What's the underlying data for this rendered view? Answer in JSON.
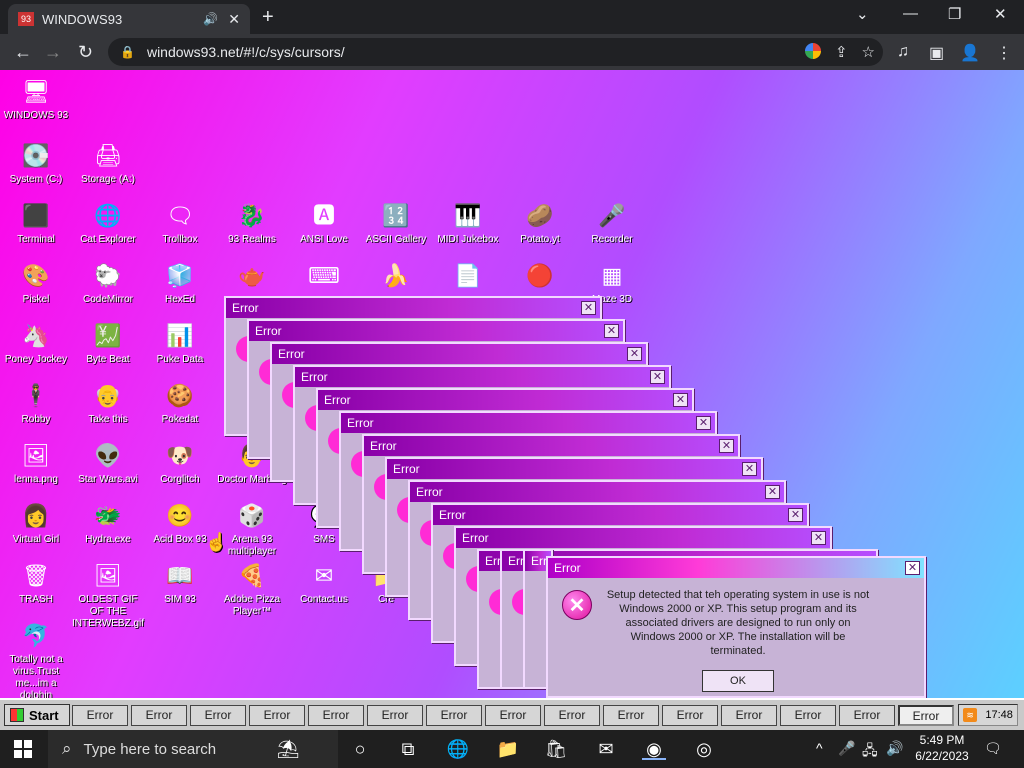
{
  "browser": {
    "tab_title": "WINDOWS93",
    "audio_icon": "🔊",
    "close_glyph": "✕",
    "newtab_glyph": "+",
    "url": "windows93.net/#!/c/sys/cursors/",
    "lock_glyph": "🔒",
    "back": "←",
    "forward": "→",
    "reload": "↻",
    "winctl": {
      "chevron": "⌄",
      "min": "—",
      "max": "❐",
      "close": "✕"
    },
    "omni_icons": {
      "share": "⇪",
      "star": "☆"
    },
    "toolbar_icons": {
      "media": "♫",
      "sidepanel": "▣",
      "profile": "👤",
      "menu": "⋮"
    }
  },
  "desktop": {
    "icons": [
      {
        "label": "WINDOWS 93",
        "glyph": "🖥"
      },
      {
        "label": "System (C:)",
        "glyph": "💽"
      },
      {
        "label": "Storage (A:)",
        "glyph": "🖨"
      },
      {
        "label": "Terminal",
        "glyph": "⬛"
      },
      {
        "label": "Cat Explorer",
        "glyph": "🌐"
      },
      {
        "label": "Trollbox",
        "glyph": "🗨"
      },
      {
        "label": "93 Realms",
        "glyph": "🐉"
      },
      {
        "label": "ANSI Love",
        "glyph": "🅰"
      },
      {
        "label": "ASCII Gallery",
        "glyph": "🔢"
      },
      {
        "label": "MIDI Jukebox",
        "glyph": "🎹"
      },
      {
        "label": "Potato.yt",
        "glyph": "🥔"
      },
      {
        "label": "Recorder",
        "glyph": "🎤"
      },
      {
        "label": "Piskel",
        "glyph": "🎨"
      },
      {
        "label": "CodeMirror",
        "glyph": "🐑"
      },
      {
        "label": "HexEd",
        "glyph": "🧊"
      },
      {
        "label": "",
        "glyph": "🫖"
      },
      {
        "label": "",
        "glyph": "⌨"
      },
      {
        "label": "",
        "glyph": "🍌"
      },
      {
        "label": "",
        "glyph": "📄"
      },
      {
        "label": "",
        "glyph": "🔴"
      },
      {
        "label": "Maze 3D",
        "glyph": "▦"
      },
      {
        "label": "Poney Jockey",
        "glyph": "🦄"
      },
      {
        "label": "Byte Beat",
        "glyph": "💹"
      },
      {
        "label": "Puke Data",
        "glyph": "📊"
      },
      {
        "label": "Robby",
        "glyph": "🕴"
      },
      {
        "label": "Take this",
        "glyph": "👴"
      },
      {
        "label": "Pokedat",
        "glyph": "🍪"
      },
      {
        "label": "lenna.png",
        "glyph": "🖼"
      },
      {
        "label": "Star Wars.avi",
        "glyph": "👽"
      },
      {
        "label": "Corglitch",
        "glyph": "🐶"
      },
      {
        "label": "Doctor Marburg",
        "glyph": "👨"
      },
      {
        "label": "Virtual Girl",
        "glyph": "👩"
      },
      {
        "label": "Hydra.exe",
        "glyph": "🐲"
      },
      {
        "label": "Acid Box 93",
        "glyph": "😊"
      },
      {
        "label": "Arena 93 multiplayer",
        "glyph": "🎲"
      },
      {
        "label": "SMS",
        "glyph": "💬"
      },
      {
        "label": "TRASH",
        "glyph": "🗑"
      },
      {
        "label": "OLDEST GIF OF THE INTERWEBZ.gif",
        "glyph": "🖼"
      },
      {
        "label": "SIM 93",
        "glyph": "📖"
      },
      {
        "label": "Adobe Pizza Player™",
        "glyph": "🍕"
      },
      {
        "label": "Contact.us",
        "glyph": "✉"
      },
      {
        "label": "Cre",
        "glyph": "📁"
      },
      {
        "label": "Totally not a virus.Trust me...im a dolphin",
        "glyph": "🐬"
      }
    ],
    "error_window_title": "Error",
    "error_back_titles": [
      "Error",
      "Error",
      "Error",
      "Error",
      "Error",
      "Error",
      "Error",
      "Error",
      "Error",
      "Error",
      "Error",
      "Err",
      "Err"
    ],
    "main_dialog": {
      "title": "Error",
      "message": "Setup detected that teh operating system in use is not Windows 2000 or XP. This setup program and its associated drivers are designed to run only on Windows 2000 or XP. The installation will be terminated.",
      "ok_label": "OK",
      "close_glyph": "✕",
      "icon_glyph": "✕"
    }
  },
  "w93_taskbar": {
    "start_label": "Start",
    "buttons": [
      "Error",
      "Error",
      "Error",
      "Error",
      "Error",
      "Error",
      "Error",
      "Error",
      "Error",
      "Error",
      "Error",
      "Error",
      "Error",
      "Error",
      "Error"
    ],
    "time": "17:48",
    "rss": "≋"
  },
  "win_taskbar": {
    "search_placeholder": "Type here to search",
    "search_glyph": "⌕",
    "time": "5:49 PM",
    "date": "6/22/2023",
    "apps": [
      "○",
      "⧉",
      "🌐",
      "📁",
      "🛍",
      "✉",
      "◉",
      "◎"
    ],
    "tray": {
      "chevron": "^",
      "mic": "🎤",
      "net": "🖧",
      "vol": "🔊",
      "notif": "🗨"
    }
  }
}
